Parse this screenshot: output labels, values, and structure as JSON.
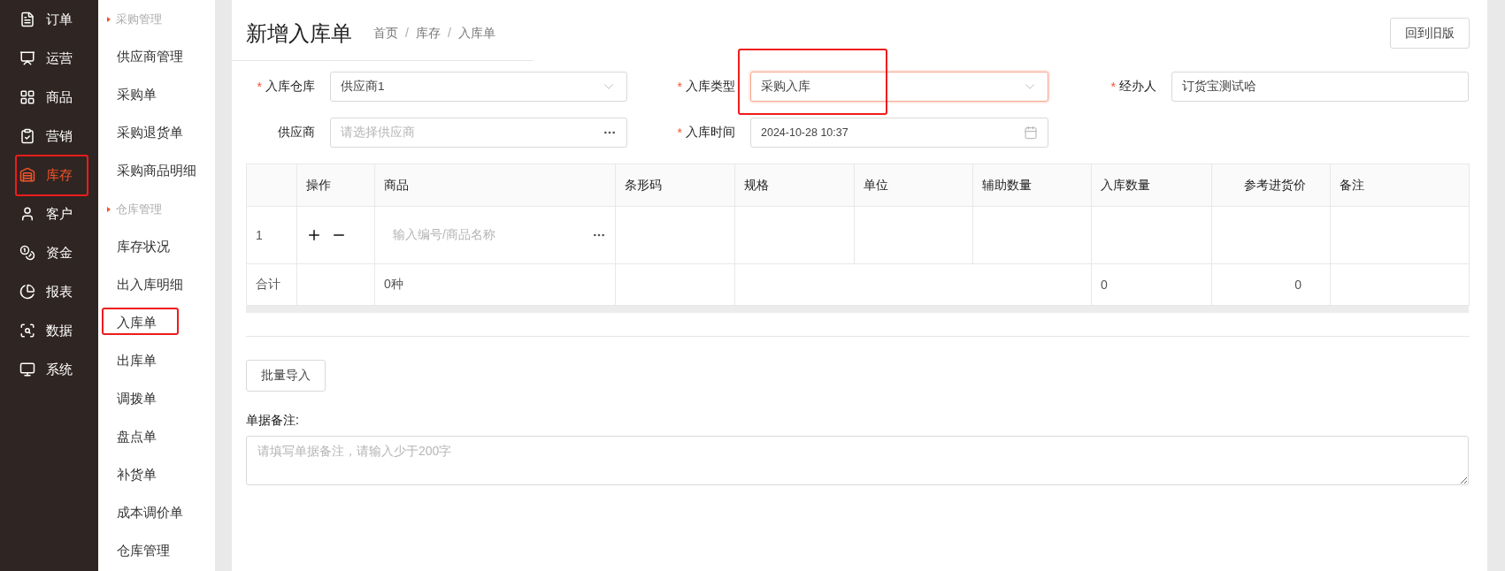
{
  "nav": {
    "items": [
      {
        "label": "订单",
        "selected": false,
        "highlighted": false
      },
      {
        "label": "运营",
        "selected": false,
        "highlighted": false
      },
      {
        "label": "商品",
        "selected": false,
        "highlighted": false
      },
      {
        "label": "营销",
        "selected": false,
        "highlighted": false
      },
      {
        "label": "库存",
        "selected": true,
        "highlighted": true
      },
      {
        "label": "客户",
        "selected": false,
        "highlighted": false
      },
      {
        "label": "资金",
        "selected": false,
        "highlighted": false
      },
      {
        "label": "报表",
        "selected": false,
        "highlighted": false
      },
      {
        "label": "数据",
        "selected": false,
        "highlighted": false
      },
      {
        "label": "系统",
        "selected": false,
        "highlighted": false
      }
    ]
  },
  "subnav": {
    "items": [
      {
        "kind": "section",
        "label": "采购管理"
      },
      {
        "kind": "link",
        "label": "供应商管理",
        "highlighted": false
      },
      {
        "kind": "link",
        "label": "采购单",
        "highlighted": false
      },
      {
        "kind": "link",
        "label": "采购退货单",
        "highlighted": false
      },
      {
        "kind": "link",
        "label": "采购商品明细",
        "highlighted": false
      },
      {
        "kind": "section",
        "label": "仓库管理"
      },
      {
        "kind": "link",
        "label": "库存状况",
        "highlighted": false
      },
      {
        "kind": "link",
        "label": "出入库明细",
        "highlighted": false
      },
      {
        "kind": "link",
        "label": "入库单",
        "highlighted": true
      },
      {
        "kind": "link",
        "label": "出库单",
        "highlighted": false
      },
      {
        "kind": "link",
        "label": "调拨单",
        "highlighted": false
      },
      {
        "kind": "link",
        "label": "盘点单",
        "highlighted": false
      },
      {
        "kind": "link",
        "label": "补货单",
        "highlighted": false
      },
      {
        "kind": "link",
        "label": "成本调价单",
        "highlighted": false
      },
      {
        "kind": "link",
        "label": "仓库管理",
        "highlighted": false
      }
    ]
  },
  "header": {
    "title": "新增入库单",
    "breadcrumb": [
      {
        "kind": "link",
        "text": "首页"
      },
      {
        "kind": "separator",
        "text": "/"
      },
      {
        "kind": "link",
        "text": "库存"
      },
      {
        "kind": "separator",
        "text": "/"
      },
      {
        "kind": "link",
        "text": "入库单"
      }
    ],
    "button": "回到旧版"
  },
  "form": {
    "rows": [
      [
        {
          "label": "入库仓库",
          "required_mark": "*",
          "kind": "select",
          "value": "供应商1",
          "focused": false,
          "highlighted": false
        },
        {
          "label": "入库类型",
          "required_mark": "*",
          "kind": "select",
          "value": "采购入库",
          "focused": true,
          "highlighted": true
        },
        {
          "label": "经办人",
          "required_mark": "*",
          "kind": "text",
          "value": "订货宝测试哈",
          "focused": false,
          "highlighted": false
        }
      ],
      [
        {
          "label": "供应商",
          "kind": "picker",
          "placeholder": "请选择供应商",
          "focused": false,
          "highlighted": false
        },
        {
          "label": "入库时间",
          "required_mark": "*",
          "kind": "date",
          "value": "2024-10-28 10:37",
          "focused": false,
          "highlighted": false
        }
      ]
    ]
  },
  "table": {
    "columns": [
      "操作",
      "商品",
      "条形码",
      "规格",
      "单位",
      "辅助数量",
      "入库数量",
      "参考进货价",
      "备注"
    ],
    "rows": [
      {
        "index": "1",
        "product_placeholder": "输入编号/商品名称"
      }
    ],
    "totals": {
      "label": "合计",
      "product_count": "0种",
      "quantity": "0",
      "price": "0"
    }
  },
  "import_button": "批量导入",
  "note": {
    "label": "单据备注:",
    "placeholder": "请填写单据备注，请输入少于200字"
  }
}
